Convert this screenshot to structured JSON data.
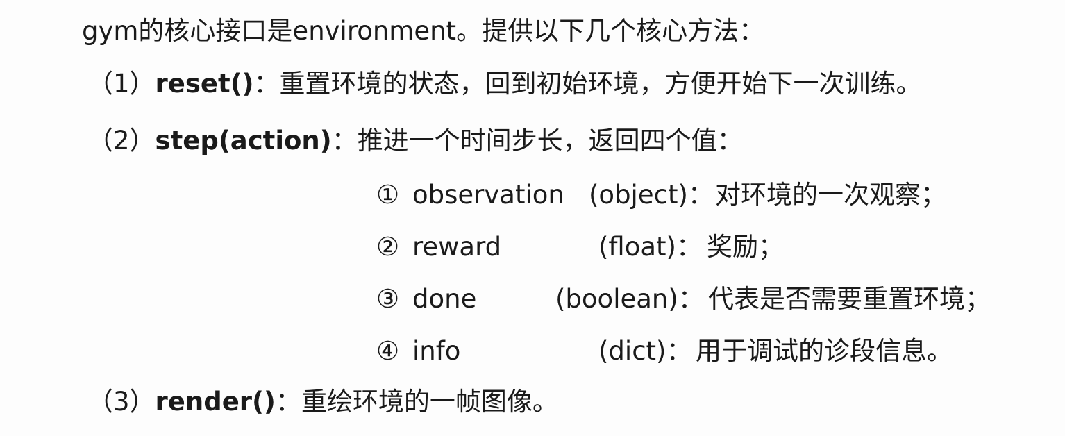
{
  "intro": "gym的核心接口是environment。提供以下几个核心方法：",
  "items": [
    {
      "number": "（1）",
      "method": "reset()",
      "colon": "：",
      "description": "重置环境的状态，回到初始环境，方便开始下一次训练。"
    },
    {
      "number": "（2）",
      "method": "step(action)",
      "colon": "：",
      "description": "推进一个时间步长，返回四个值："
    },
    {
      "number": "（3）",
      "method": "render()",
      "colon": "：",
      "description": "重绘环境的一帧图像。"
    }
  ],
  "step_returns": [
    {
      "marker": "①",
      "name": "observation",
      "type": "(object)：",
      "description": "对环境的一次观察；"
    },
    {
      "marker": "②",
      "name": "reward",
      "type": "(float)：",
      "description": "奖励；"
    },
    {
      "marker": "③",
      "name": "done",
      "type": "(boolean)：",
      "description": "代表是否需要重置环境；"
    },
    {
      "marker": "④",
      "name": "info",
      "type": "(dict)：",
      "description": "用于调试的诊段信息。"
    }
  ]
}
